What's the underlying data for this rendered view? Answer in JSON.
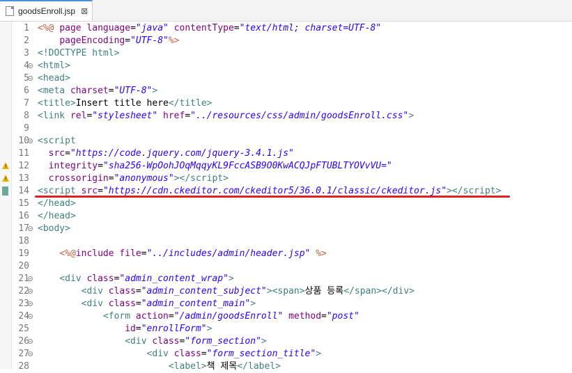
{
  "tab": {
    "filename": "goodsEnroll.jsp",
    "close": "⊠"
  },
  "lines": [
    {
      "n": "1",
      "fold": false,
      "marker": "",
      "html": "<span class=\"jsp\">&lt;%@</span> <span class=\"a\">page</span> <span class=\"a\">language</span>=<span class=\"v\">\"java\"</span> <span class=\"a\">contentType</span>=<span class=\"v\">\"text/html; charset=UTF-8\"</span>"
    },
    {
      "n": "2",
      "fold": false,
      "marker": "",
      "html": "    <span class=\"a\">pageEncoding</span>=<span class=\"v\">\"UTF-8\"</span><span class=\"jsp\">%&gt;</span>"
    },
    {
      "n": "3",
      "fold": false,
      "marker": "",
      "html": "<span class=\"k\">&lt;!DOCTYPE html&gt;</span>"
    },
    {
      "n": "4",
      "fold": true,
      "marker": "",
      "html": "<span class=\"k\">&lt;html&gt;</span>"
    },
    {
      "n": "5",
      "fold": true,
      "marker": "",
      "html": "<span class=\"k\">&lt;head&gt;</span>"
    },
    {
      "n": "6",
      "fold": false,
      "marker": "",
      "html": "<span class=\"k\">&lt;meta</span> <span class=\"a\">charset</span>=<span class=\"v\">\"UTF-8\"</span><span class=\"k\">&gt;</span>"
    },
    {
      "n": "7",
      "fold": false,
      "marker": "",
      "html": "<span class=\"k\">&lt;title&gt;</span>Insert title here<span class=\"k\">&lt;/title&gt;</span>"
    },
    {
      "n": "8",
      "fold": false,
      "marker": "",
      "html": "<span class=\"k\">&lt;link</span> <span class=\"a\">rel</span>=<span class=\"v\">\"stylesheet\"</span> <span class=\"a\">href</span>=<span class=\"v\">\"../resources/css/admin/goodsEnroll.css\"</span><span class=\"k\">&gt;</span>"
    },
    {
      "n": "9",
      "fold": false,
      "marker": "",
      "html": ""
    },
    {
      "n": "10",
      "fold": true,
      "marker": "",
      "html": "<span class=\"k\">&lt;script</span>"
    },
    {
      "n": "11",
      "fold": false,
      "marker": "",
      "html": "  <span class=\"a\">src</span>=<span class=\"v\">\"https://code.jquery.com/jquery-3.4.1.js\"</span>"
    },
    {
      "n": "12",
      "fold": false,
      "marker": "warn",
      "html": "  <span class=\"a\">integrity</span>=<span class=\"v\">\"sha256-WpOohJOqMqqyKL9FccASB9O0KwACQJpFTUBLTYOVvVU=\"</span>"
    },
    {
      "n": "13",
      "fold": false,
      "marker": "warn",
      "html": "  <span class=\"a\">crossorigin</span>=<span class=\"v\">\"anonymous\"</span><span class=\"k\">&gt;&lt;/script&gt;</span>"
    },
    {
      "n": "14",
      "fold": false,
      "marker": "bookmark",
      "html": "<span class=\"k\">&lt;script</span> <span class=\"a\">src</span>=<span class=\"v\">\"https://cdn.ckeditor.com/ckeditor5/36.0.1/classic/ckeditor.js\"</span><span class=\"k\">&gt;&lt;/script&gt;</span>"
    },
    {
      "n": "15",
      "fold": false,
      "marker": "",
      "html": "<span class=\"k\">&lt;/head&gt;</span>"
    },
    {
      "n": "16",
      "fold": false,
      "marker": "",
      "html": "<span class=\"k\">&lt;/head&gt;</span>"
    },
    {
      "n": "17",
      "fold": true,
      "marker": "",
      "html": "<span class=\"k\">&lt;body&gt;</span>"
    },
    {
      "n": "18",
      "fold": false,
      "marker": "",
      "html": ""
    },
    {
      "n": "19",
      "fold": false,
      "marker": "",
      "html": "    <span class=\"jsp\">&lt;%@</span><span class=\"a\">include</span> <span class=\"a\">file</span>=<span class=\"v\">\"../includes/admin/header.jsp\"</span> <span class=\"jsp\">%&gt;</span>"
    },
    {
      "n": "20",
      "fold": false,
      "marker": "",
      "html": ""
    },
    {
      "n": "21",
      "fold": true,
      "marker": "",
      "html": "    <span class=\"k\">&lt;div</span> <span class=\"a\">class</span>=<span class=\"v\">\"admin_content_wrap\"</span><span class=\"k\">&gt;</span>"
    },
    {
      "n": "22",
      "fold": true,
      "marker": "",
      "html": "        <span class=\"k\">&lt;div</span> <span class=\"a\">class</span>=<span class=\"v\">\"admin_content_subject\"</span><span class=\"k\">&gt;&lt;span&gt;</span>상품 등록<span class=\"k\">&lt;/span&gt;&lt;/div&gt;</span>"
    },
    {
      "n": "23",
      "fold": true,
      "marker": "",
      "html": "        <span class=\"k\">&lt;div</span> <span class=\"a\">class</span>=<span class=\"v\">\"admin_content_main\"</span><span class=\"k\">&gt;</span>"
    },
    {
      "n": "24",
      "fold": true,
      "marker": "",
      "html": "            <span class=\"k\">&lt;form</span> <span class=\"a\">action</span>=<span class=\"v\">\"/admin/goodsEnroll\"</span> <span class=\"a\">method</span>=<span class=\"v\">\"post\"</span>"
    },
    {
      "n": "25",
      "fold": false,
      "marker": "",
      "html": "                <span class=\"a\">id</span>=<span class=\"v\">\"enrollForm\"</span><span class=\"k\">&gt;</span>"
    },
    {
      "n": "26",
      "fold": true,
      "marker": "",
      "html": "                <span class=\"k\">&lt;div</span> <span class=\"a\">class</span>=<span class=\"v\">\"form_section\"</span><span class=\"k\">&gt;</span>"
    },
    {
      "n": "27",
      "fold": true,
      "marker": "",
      "html": "                    <span class=\"k\">&lt;div</span> <span class=\"a\">class</span>=<span class=\"v\">\"form_section_title\"</span><span class=\"k\">&gt;</span>"
    },
    {
      "n": "28",
      "fold": false,
      "marker": "",
      "html": "                        <span class=\"k\">&lt;label&gt;</span>책 제목<span class=\"k\">&lt;/label&gt;</span>"
    }
  ]
}
